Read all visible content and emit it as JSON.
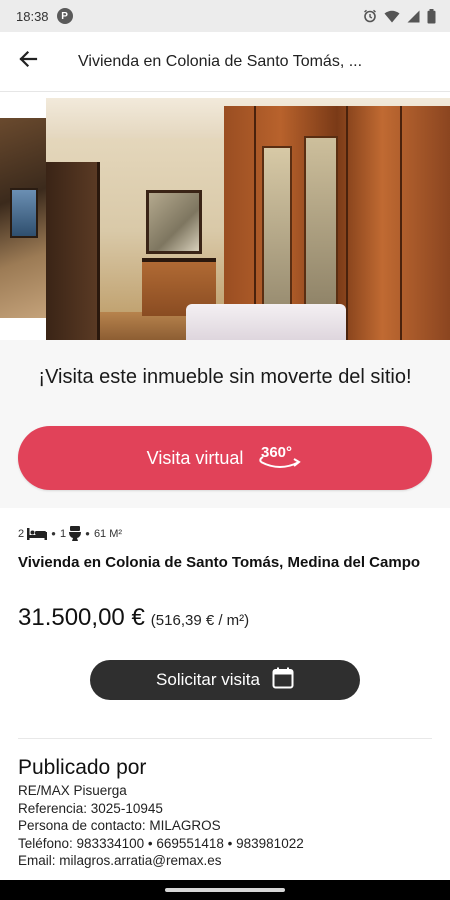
{
  "status_bar": {
    "time": "18:38",
    "notification_badge": "P",
    "icons": [
      "alarm-icon",
      "wifi-icon",
      "signal-icon",
      "battery-icon"
    ]
  },
  "app_bar": {
    "back_icon": "arrow-left-icon",
    "title": "Vivienda en Colonia de Santo Tomás, ..."
  },
  "gallery": {
    "images": [
      "bedroom-thumbnail-previous",
      "bedroom-with-wardrobe"
    ]
  },
  "virtual_visit": {
    "heading": "¡Visita este inmueble sin moverte del sitio!",
    "button_label": "Visita virtual",
    "button_icon": "360-icon",
    "button_icon_text": "360°"
  },
  "listing": {
    "features": {
      "bedrooms": "2",
      "bathrooms": "1",
      "area": "61 M²",
      "bed_icon": "bed-icon",
      "toilet_icon": "toilet-icon"
    },
    "title": "Vivienda en Colonia de Santo Tomás, Medina del Campo",
    "price": "31.500,00 €",
    "price_per_m2": "(516,39 € / m²)"
  },
  "request_visit": {
    "label": "Solicitar visita",
    "icon": "calendar-icon"
  },
  "publisher": {
    "heading": "Publicado por",
    "agency": "RE/MAX Pisuerga",
    "reference": "Referencia: 3025-10945",
    "contact": "Persona de contacto: MILAGROS",
    "phones": "Teléfono: 983334100 • 669551418 • 983981022",
    "email": "Email: milagros.arratia@remax.es"
  },
  "colors": {
    "accent": "#e14259",
    "dark_button": "#2f2f2f",
    "section_background": "#f7f7f7"
  }
}
